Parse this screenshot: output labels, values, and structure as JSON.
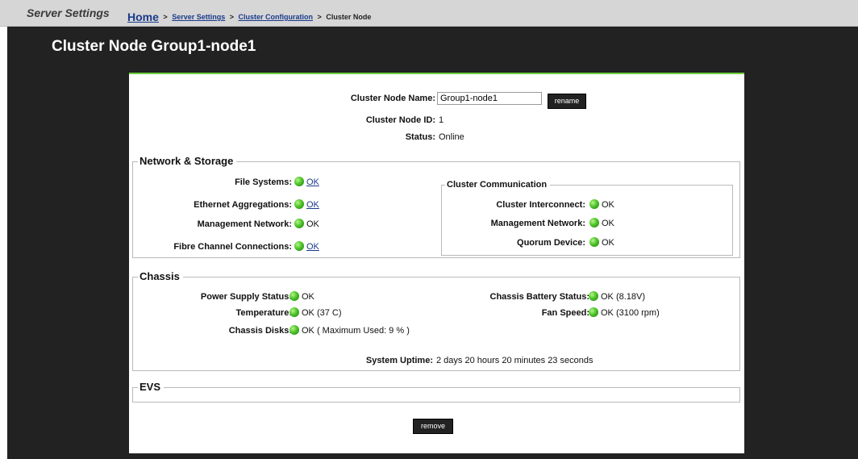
{
  "header": {
    "app_title": "Server Settings",
    "breadcrumb": {
      "home": "Home",
      "sep": ">",
      "crumb1": "Server Settings",
      "crumb2": "Cluster Configuration",
      "current": "Cluster Node"
    }
  },
  "page_title": "Cluster Node Group1-node1",
  "node": {
    "name_label": "Cluster Node Name:",
    "name_value": "Group1-node1",
    "rename_label": "rename",
    "id_label": "Cluster Node ID:",
    "id_value": "1",
    "status_label": "Status:",
    "status_value": "Online"
  },
  "network_storage": {
    "title": "Network & Storage",
    "file_systems_label": "File Systems:",
    "file_systems_value": "OK",
    "eth_agg_label": "Ethernet Aggregations:",
    "eth_agg_value": "OK",
    "mgmt_net_label": "Management Network:",
    "mgmt_net_value": "OK",
    "fc_label": "Fibre Channel Connections:",
    "fc_value": "OK"
  },
  "cluster_communication": {
    "title": "Cluster Communication",
    "interconnect_label": "Cluster Interconnect:",
    "interconnect_value": "OK",
    "mgmt_net_label": "Management Network:",
    "mgmt_net_value": "OK",
    "quorum_label": "Quorum Device:",
    "quorum_value": "OK"
  },
  "chassis": {
    "title": "Chassis",
    "psu_label": "Power Supply Status:",
    "psu_value": "OK",
    "temp_label": "Temperature:",
    "temp_value": "OK (37 C)",
    "disks_label": "Chassis Disks:",
    "disks_value": "OK ( Maximum Used: 9 % )",
    "battery_label": "Chassis Battery Status:",
    "battery_value": "OK (8.18V)",
    "fan_label": "Fan Speed:",
    "fan_value": "OK (3100 rpm)",
    "uptime_label": "System Uptime:",
    "uptime_value": "2 days 20 hours 20 minutes 23 seconds"
  },
  "evs": {
    "title": "EVS"
  },
  "remove_label": "remove",
  "colors": {
    "status_ok": "#4fc42a",
    "accent": "#6ccf3f",
    "link": "#1a3a8a",
    "dark_bg": "#222222"
  }
}
